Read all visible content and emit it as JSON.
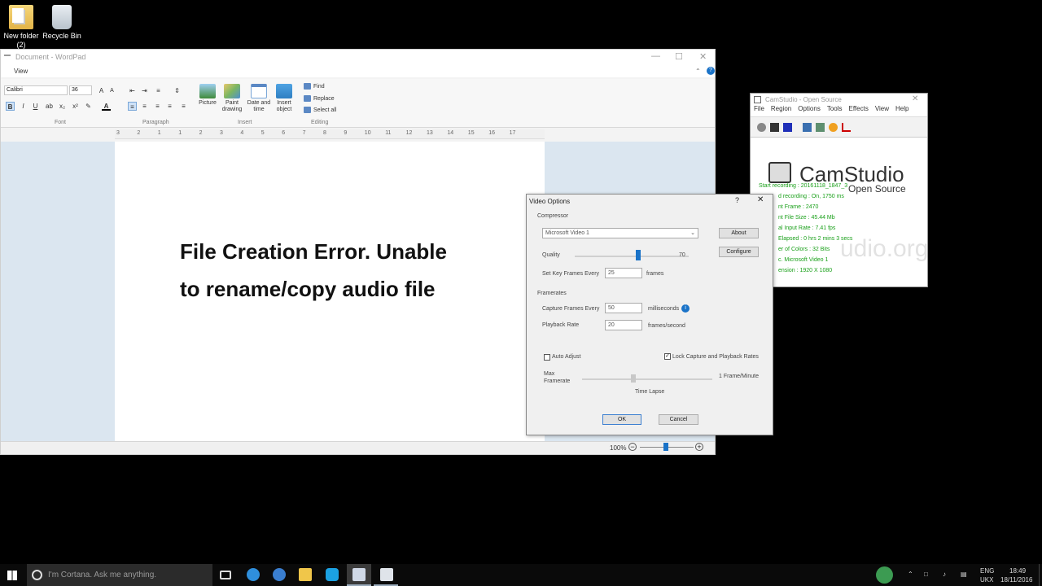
{
  "desktop": {
    "icons": [
      {
        "label": "New folder (2)",
        "icon": "folder-icon"
      },
      {
        "label": "Recycle Bin",
        "icon": "recycle-bin-icon"
      }
    ]
  },
  "wordpad": {
    "title": "Document - WordPad",
    "menu_tab": "View",
    "font_name": "Calibri",
    "font_size": "36",
    "groups": {
      "font": "Font",
      "paragraph": "Paragraph",
      "insert": "Insert",
      "editing": "Editing"
    },
    "insert_buttons": [
      "Picture",
      "Paint drawing",
      "Date and time",
      "Insert object"
    ],
    "editing_buttons": [
      "Find",
      "Replace",
      "Select all"
    ],
    "document_text": [
      "File Creation Error. Unable",
      "to rename/copy audio file"
    ],
    "ruler_numbers": [
      "3",
      "2",
      "1",
      "1",
      "2",
      "3",
      "4",
      "5",
      "6",
      "7",
      "8",
      "9",
      "10",
      "11",
      "12",
      "13",
      "14",
      "15",
      "16",
      "17"
    ],
    "zoom": "100%"
  },
  "camstudio": {
    "title": "CamStudio - Open Source",
    "menu": [
      "File",
      "Region",
      "Options",
      "Tools",
      "Effects",
      "View",
      "Help"
    ],
    "logo": "CamStudio",
    "logo_sub": "Open Source",
    "watermark": "udio.org",
    "stats": [
      "Start recording : 20161118_1847_3",
      "d recording : On, 1750 ms",
      "nt Frame : 2470",
      "nt File Size : 45.44 Mb",
      "al Input Rate : 7.41 fps",
      "Elapsed : 0 hrs 2 mins 3 secs",
      "er of Colors : 32 Bits",
      "c. Microsoft Video 1",
      "ension : 1920 X 1080"
    ]
  },
  "video_options": {
    "title": "Video Options",
    "compressor_label": "Compressor",
    "compressor_value": "Microsoft Video 1",
    "about_button": "About",
    "quality_label": "Quality",
    "quality_value": "70",
    "quality_level": 0.7,
    "configure_button": "Configure",
    "keyframes_label": "Set Key Frames Every",
    "keyframes_value": "25",
    "keyframes_unit": "frames",
    "framerates_label": "Framerates",
    "capture_label": "Capture Frames Every",
    "capture_value": "50",
    "capture_unit": "milliseconds",
    "playback_label": "Playback Rate",
    "playback_value": "20",
    "playback_unit": "frames/second",
    "auto_adjust_label": "Auto Adjust",
    "auto_adjust_checked": false,
    "lock_label": "Lock Capture and Playback Rates",
    "lock_checked": true,
    "max_framerate_label": "Max Framerate",
    "framerate_value": "1 Frame/Minute",
    "time_lapse_label": "Time Lapse",
    "ok_button": "OK",
    "cancel_button": "Cancel"
  },
  "taskbar": {
    "cortana_placeholder": "I'm Cortana. Ask me anything.",
    "lang_top": "ENG",
    "lang_bottom": "UKX",
    "time": "18:49",
    "date": "18/11/2016"
  }
}
